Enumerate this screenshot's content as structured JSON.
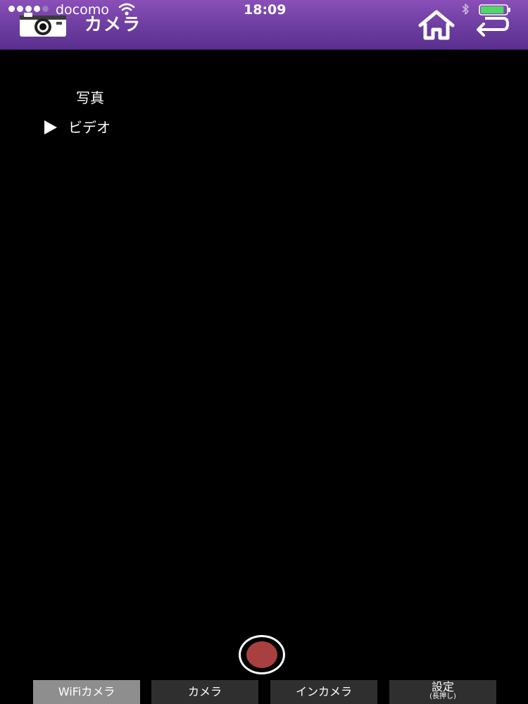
{
  "status_bar": {
    "carrier": "docomo",
    "time": "18:09",
    "signal_bars": 4,
    "battery_level": 0.9,
    "battery_color": "#4cd964",
    "icons": [
      "signal-dots",
      "wifi-icon",
      "bluetooth-icon",
      "battery-icon"
    ]
  },
  "header": {
    "title": "カメラ",
    "app_icon": "camera-icon",
    "home_icon": "home-icon",
    "back_icon": "return-arrow-icon",
    "bar_color": "#6c3da0"
  },
  "mode_menu": {
    "items": [
      {
        "label": "写真",
        "selected": false
      },
      {
        "label": "ビデオ",
        "selected": true
      }
    ],
    "selector_icon": "play-triangle-icon"
  },
  "record_button": {
    "icon": "record-icon",
    "color": "#a84040"
  },
  "tabs": [
    {
      "label": "WiFiカメラ",
      "active": true
    },
    {
      "label": "カメラ",
      "active": false
    },
    {
      "label": "インカメラ",
      "active": false
    },
    {
      "label": "設定",
      "sublabel": "(長押し)",
      "active": false
    }
  ]
}
